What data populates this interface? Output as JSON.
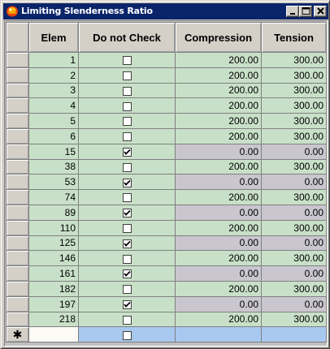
{
  "window": {
    "title": "Limiting Slenderness Ratio"
  },
  "columns": [
    "Elem",
    "Do not Check",
    "Compression",
    "Tension"
  ],
  "rows": [
    {
      "elem": "1",
      "checked": false,
      "compression": "200.00",
      "tension": "300.00"
    },
    {
      "elem": "2",
      "checked": false,
      "compression": "200.00",
      "tension": "300.00"
    },
    {
      "elem": "3",
      "checked": false,
      "compression": "200.00",
      "tension": "300.00"
    },
    {
      "elem": "4",
      "checked": false,
      "compression": "200.00",
      "tension": "300.00"
    },
    {
      "elem": "5",
      "checked": false,
      "compression": "200.00",
      "tension": "300.00"
    },
    {
      "elem": "6",
      "checked": false,
      "compression": "200.00",
      "tension": "300.00"
    },
    {
      "elem": "15",
      "checked": true,
      "compression": "0.00",
      "tension": "0.00"
    },
    {
      "elem": "38",
      "checked": false,
      "compression": "200.00",
      "tension": "300.00"
    },
    {
      "elem": "53",
      "checked": true,
      "compression": "0.00",
      "tension": "0.00"
    },
    {
      "elem": "74",
      "checked": false,
      "compression": "200.00",
      "tension": "300.00"
    },
    {
      "elem": "89",
      "checked": true,
      "compression": "0.00",
      "tension": "0.00"
    },
    {
      "elem": "110",
      "checked": false,
      "compression": "200.00",
      "tension": "300.00"
    },
    {
      "elem": "125",
      "checked": true,
      "compression": "0.00",
      "tension": "0.00"
    },
    {
      "elem": "146",
      "checked": false,
      "compression": "200.00",
      "tension": "300.00"
    },
    {
      "elem": "161",
      "checked": true,
      "compression": "0.00",
      "tension": "0.00"
    },
    {
      "elem": "182",
      "checked": false,
      "compression": "200.00",
      "tension": "300.00"
    },
    {
      "elem": "197",
      "checked": true,
      "compression": "0.00",
      "tension": "0.00"
    },
    {
      "elem": "218",
      "checked": false,
      "compression": "200.00",
      "tension": "300.00"
    }
  ],
  "new_row": {
    "marker": "✱",
    "checked": false
  },
  "colors": {
    "titlebar": "#0a246a",
    "cell": "#c8e0c8",
    "disabled_cell": "#c9c6cf",
    "new_row": "#a8c8f0"
  },
  "icons": [
    "app-icon",
    "minimize-icon",
    "maximize-icon",
    "close-icon",
    "checkmark-icon",
    "new-row-star-icon"
  ]
}
